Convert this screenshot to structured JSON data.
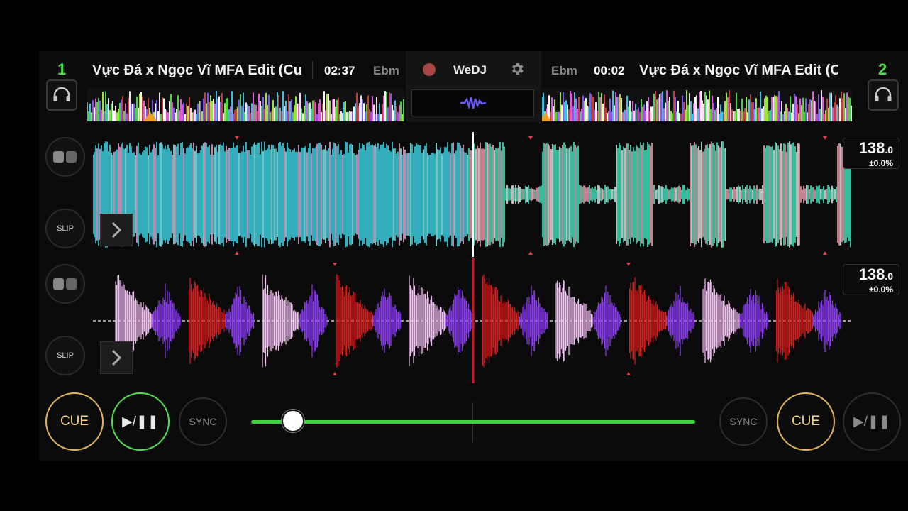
{
  "deck_left": {
    "number": "1",
    "title": "Vực Đá x Ngọc Vĩ MFA Edit (Cu",
    "time": "02:37",
    "key": "Ebm",
    "bpm": "138",
    "bpm_decimal": ".0",
    "pitch": "±0.0%"
  },
  "deck_right": {
    "number": "2",
    "title": "Vực Đá x Ngọc Vĩ MFA Edit (Cu",
    "time": "00:02",
    "key": "Ebm",
    "bpm": "138",
    "bpm_decimal": ".0",
    "pitch": "±0.0%"
  },
  "brand": "WeDJ",
  "slip_label": "SLIP",
  "controls": {
    "cue_label": "CUE",
    "play_label": "▶/❚❚",
    "sync_label": "SYNC"
  },
  "crossfader": {
    "position": 0.07
  },
  "colors": {
    "accent_green": "#4be04b",
    "cue_gold": "#e3b45a",
    "record_red": "#b04040"
  },
  "icons": [
    "headphones-icon",
    "record-icon",
    "gear-icon",
    "waveform-icon",
    "chevron-right-icon",
    "pad-icon"
  ]
}
